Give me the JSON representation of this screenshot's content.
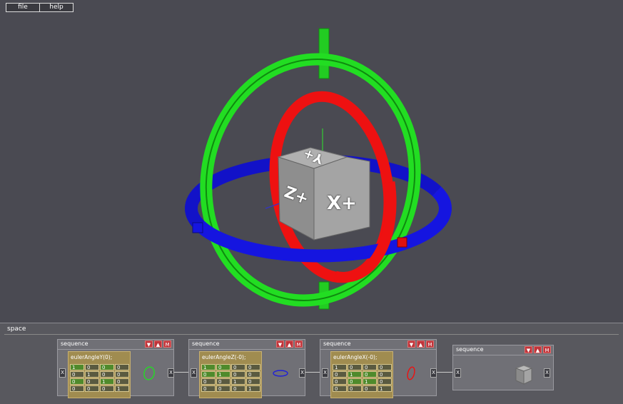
{
  "menu": {
    "file": "file",
    "help": "help"
  },
  "scene": {
    "cube_labels": {
      "x": "X+",
      "y": "Y+",
      "z": "Z+"
    },
    "colors": {
      "background": "#4a4a52",
      "green_ring": "#22dd22",
      "red_ring": "#ee1111",
      "blue_ring": "#1515e0",
      "cube": "#9a9a9a"
    }
  },
  "panel": {
    "title": "space"
  },
  "nodes": [
    {
      "title": "sequence",
      "code": "eulerAngleY(0);",
      "matrix": [
        [
          "1",
          "0",
          "0",
          "0"
        ],
        [
          "0",
          "1",
          "0",
          "0"
        ],
        [
          "0",
          "0",
          "1",
          "0"
        ],
        [
          "0",
          "0",
          "0",
          "1"
        ]
      ],
      "glyph_color": "#22dd22"
    },
    {
      "title": "sequence",
      "code": "eulerAngleZ(-0);",
      "matrix": [
        [
          "1",
          "0",
          "0",
          "0"
        ],
        [
          "0",
          "1",
          "0",
          "0"
        ],
        [
          "0",
          "0",
          "1",
          "0"
        ],
        [
          "0",
          "0",
          "0",
          "1"
        ]
      ],
      "glyph_color": "#2020d8"
    },
    {
      "title": "sequence",
      "code": "eulerAngleX(-0);",
      "matrix": [
        [
          "1",
          "0",
          "0",
          "0"
        ],
        [
          "0",
          "1",
          "0",
          "0"
        ],
        [
          "0",
          "0",
          "1",
          "0"
        ],
        [
          "0",
          "0",
          "0",
          "1"
        ]
      ],
      "glyph_color": "#ee1111"
    },
    {
      "title": "sequence"
    }
  ],
  "node_buttons": {
    "down": "▼",
    "up": "▲",
    "menu": "M"
  },
  "x_label": "X"
}
